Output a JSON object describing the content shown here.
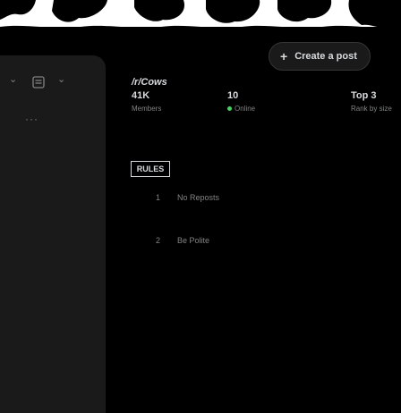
{
  "header": {
    "create_post_label": "Create a post",
    "create_post_icon": "plus-icon"
  },
  "community": {
    "name": "/r/Cows",
    "stats": [
      {
        "value": "41K",
        "label": "Members"
      },
      {
        "value": "10",
        "label": "Online"
      },
      {
        "value": "Top 3",
        "label": "Rank by size"
      }
    ]
  },
  "tabs": {
    "rules_label": "RULES"
  },
  "rules": [
    {
      "num": "1",
      "text": "No Reposts"
    },
    {
      "num": "2",
      "text": "Be Polite"
    }
  ],
  "colors": {
    "background": "#000000",
    "card": "#1a1a1b",
    "text": "#d7dadc",
    "muted": "#818384",
    "online": "#46d160"
  }
}
